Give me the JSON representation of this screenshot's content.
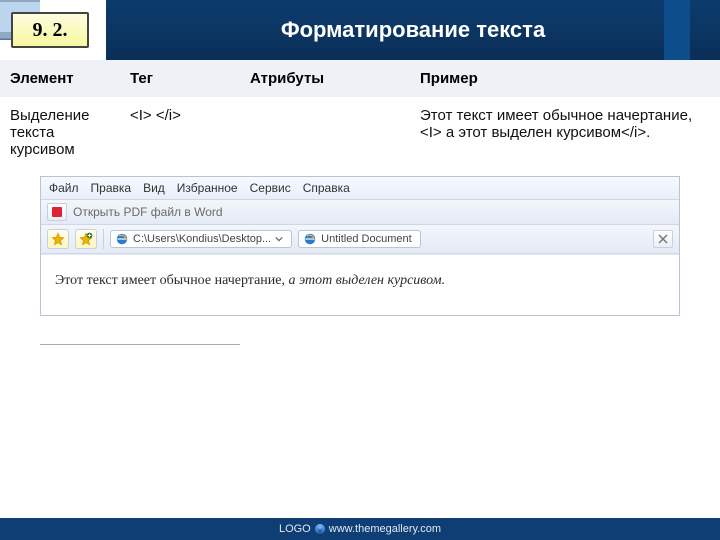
{
  "header": {
    "section_number": "9. 2.",
    "title": "Форматирование текста"
  },
  "table": {
    "headers": {
      "element": "Элемент",
      "tag": "Тег",
      "attributes": "Атрибуты",
      "example": "Пример"
    },
    "row": {
      "element": "Выделение текста курсивом",
      "tag": "<I> </i>",
      "attributes": "",
      "example": "Этот текст имеет обычное начертание, <I> а этот выделен курсивом</i>."
    }
  },
  "browser": {
    "menu": {
      "file": "Файл",
      "edit": "Правка",
      "view": "Вид",
      "favorites": "Избранное",
      "tools": "Сервис",
      "help": "Справка"
    },
    "open_pdf_label": "Открыть PDF файл в  Word",
    "address_path": "C:\\Users\\Kondius\\Desktop...",
    "tab_title": "Untitled Document",
    "page_text_plain": "Этот текст имеет обычное начертание, ",
    "page_text_italic": "а этот выделен курсивом."
  },
  "footer": {
    "logo_text": "LOGO",
    "link": "www.themegallery.com"
  }
}
